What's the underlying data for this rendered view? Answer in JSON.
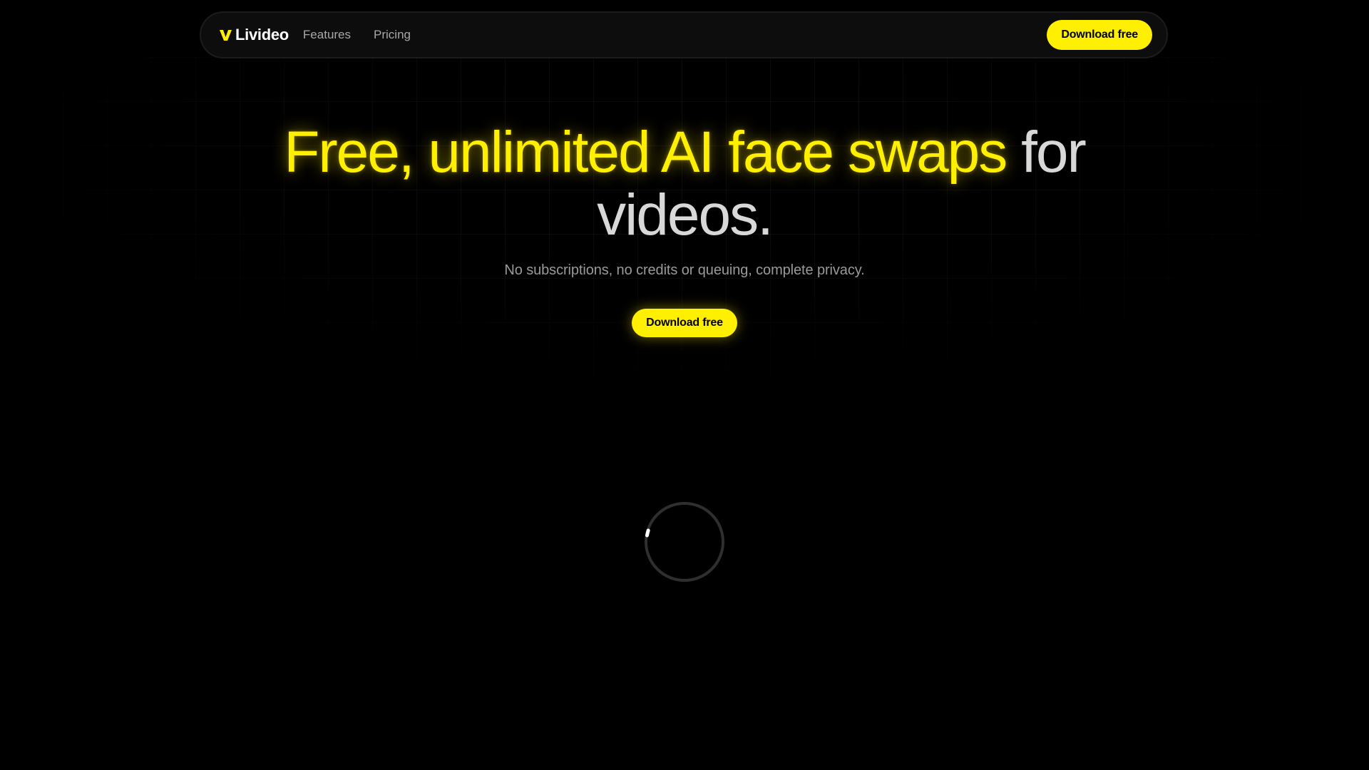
{
  "navbar": {
    "brand_name": "Livideo",
    "links": [
      "Features",
      "Pricing"
    ],
    "cta_label": "Download free"
  },
  "hero": {
    "headline_highlight": "Free, unlimited AI face swaps",
    "headline_rest": " for videos.",
    "subheadline": "No subscriptions, no credits or queuing, complete privacy.",
    "cta_label": "Download free"
  },
  "colors": {
    "accent": "#ffef00",
    "background": "#000000",
    "nav_background": "#0d0d0d",
    "muted_text": "#9a9a9a"
  },
  "icons": {
    "brand": "brand-logo-icon",
    "spinner": "loading-spinner-icon"
  }
}
